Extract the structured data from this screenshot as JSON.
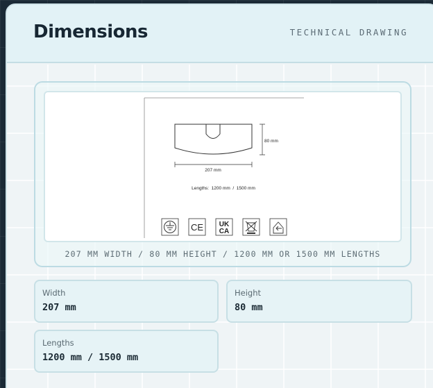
{
  "header": {
    "title": "Dimensions",
    "subtitle": "TECHNICAL DRAWING"
  },
  "drawing": {
    "width_label": "207 mm",
    "height_label": "80 mm",
    "lengths_label": "Lengths:  1200 mm  /  1500 mm",
    "cert_icons": [
      "earth-ground-icon",
      "ce-mark-icon",
      "ukca-mark-icon",
      "weee-bin-icon",
      "indoor-use-icon"
    ],
    "ce_text": "CE",
    "ukca_top": "UK",
    "ukca_bottom": "CA",
    "caption": "207 MM WIDTH / 80 MM HEIGHT / 1200 MM OR 1500 MM LENGTHS"
  },
  "specs": {
    "width": {
      "label": "Width",
      "value": "207 mm"
    },
    "height": {
      "label": "Height",
      "value": "80 mm"
    },
    "lengths": {
      "label": "Lengths",
      "value": "1200 mm / 1500 mm"
    }
  },
  "colors": {
    "background": "#1b2a36",
    "card": "#eff4f6",
    "header": "#e2f2f6",
    "border": "#c7dfe5",
    "text_dark": "#172733"
  }
}
